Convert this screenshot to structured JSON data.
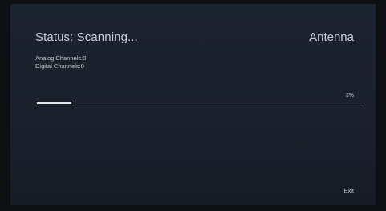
{
  "status": {
    "label": "Status: Scanning..."
  },
  "source": {
    "label": "Antenna"
  },
  "counts": {
    "analog": "Analog Channels:0",
    "digital": "Digital Channels:0"
  },
  "progress": {
    "label": "3%",
    "fraction": 0.03
  },
  "footer": {
    "exit_label": "Exit"
  }
}
